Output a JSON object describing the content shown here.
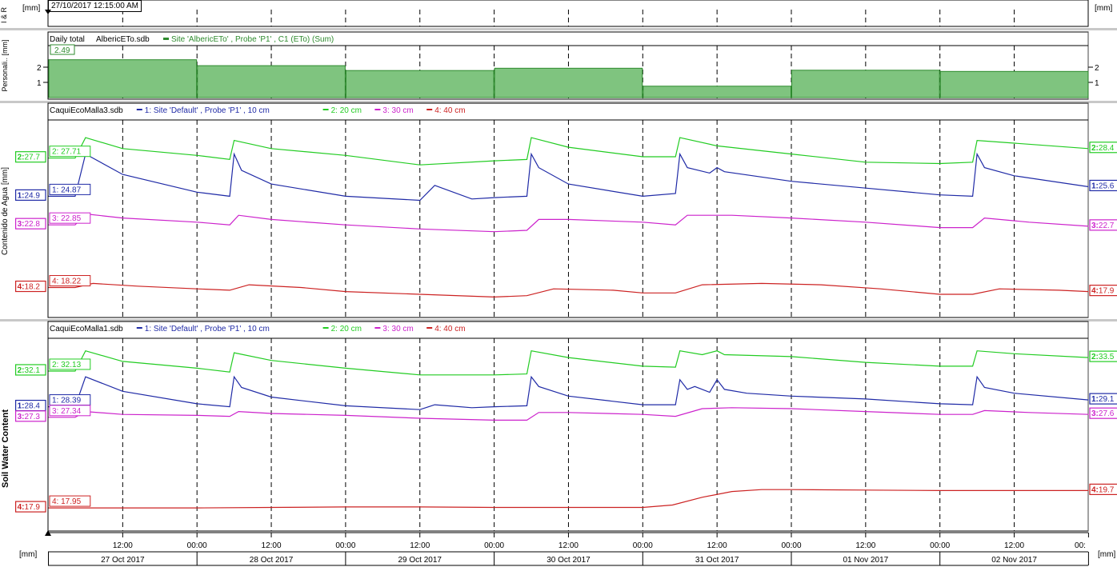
{
  "timestamp": "27/10/2017 12:15:00 AM",
  "top_panel": {
    "unit_left": "[mm]",
    "unit_right": "[mm]",
    "ylabel": "I & R"
  },
  "bottom_units": {
    "left": "[mm]",
    "right": "[mm]"
  },
  "colors": {
    "series_1": "#1f2aa6",
    "series_2": "#22cc22",
    "series_3": "#cc22cc",
    "series_4": "#cc2222",
    "bar_fill": "#7fc47f",
    "bar_edge": "#2e8b2e"
  },
  "x_axis": {
    "time_ticks": [
      "12:00",
      "00:00",
      "12:00",
      "00:00",
      "12:00",
      "00:00",
      "12:00",
      "00:00",
      "12:00",
      "00:00",
      "12:00",
      "00:00",
      "12:00",
      "00:"
    ],
    "days": [
      "27 Oct 2017",
      "28 Oct 2017",
      "29 Oct 2017",
      "30 Oct 2017",
      "31 Oct 2017",
      "01 Nov 2017",
      "02 Nov 2017"
    ]
  },
  "chart_data": [
    {
      "type": "bar",
      "panel": "Personalizado",
      "ylabel": "Personali.. [mm]",
      "legend": {
        "prefix": "Daily total",
        "file": "AlbericETo.sdb",
        "series": "Site 'AlbericETo' , Probe 'P1' , C1 (ETo) (Sum)"
      },
      "categories": [
        "27 Oct 2017",
        "28 Oct 2017",
        "29 Oct 2017",
        "30 Oct 2017",
        "31 Oct 2017",
        "01 Nov 2017",
        "02 Nov 2017"
      ],
      "values": [
        2.49,
        2.1,
        1.78,
        1.93,
        0.75,
        1.8,
        1.72
      ],
      "current_label": "2.49",
      "yticks": [
        "2",
        "1"
      ],
      "ylim": [
        0,
        3.2
      ]
    },
    {
      "type": "line",
      "panel": "CaquiEcoMalla3",
      "ylabel": "Contenido de Agua [mm]",
      "legend_file": "CaquiEcoMalla3.sdb",
      "series": [
        {
          "name": "1: Site 'Default' , Probe 'P1' , 10 cm",
          "cursor_label": "1: 24.87",
          "left_value": "1: 24.9",
          "right_value": "1: 25.6",
          "x": [
            0,
            0.18,
            0.25,
            0.5,
            1.0,
            1.22,
            1.25,
            1.3,
            1.5,
            2.0,
            2.5,
            2.6,
            2.85,
            3.0,
            3.22,
            3.25,
            3.3,
            3.5,
            4.0,
            4.22,
            4.25,
            4.3,
            4.45,
            4.5,
            4.55,
            5.0,
            5.5,
            6.0,
            6.22,
            6.25,
            6.3,
            6.5,
            7.0
          ],
          "y": [
            24.9,
            24.9,
            28.0,
            26.5,
            25.2,
            24.9,
            28.0,
            26.8,
            25.8,
            24.9,
            24.6,
            25.7,
            24.7,
            24.8,
            24.9,
            28.0,
            27.0,
            25.8,
            24.9,
            25.1,
            28.0,
            27.0,
            26.6,
            27.0,
            26.7,
            26.0,
            25.5,
            25.0,
            24.9,
            28.0,
            27.0,
            26.4,
            25.6
          ]
        },
        {
          "name": "2: 20 cm",
          "cursor_label": "2: 27.71",
          "left_value": "2: 27.7",
          "right_value": "2: 28.4",
          "x": [
            0,
            0.18,
            0.25,
            0.5,
            1.0,
            1.22,
            1.25,
            1.5,
            2.0,
            2.5,
            3.0,
            3.22,
            3.25,
            3.5,
            4.0,
            4.22,
            4.25,
            4.5,
            5.0,
            5.5,
            6.0,
            6.22,
            6.25,
            6.5,
            7.0
          ],
          "y": [
            27.7,
            27.7,
            29.2,
            28.4,
            27.9,
            27.6,
            29.0,
            28.4,
            27.9,
            27.2,
            27.5,
            27.6,
            29.2,
            28.5,
            27.8,
            27.8,
            29.2,
            28.6,
            28.0,
            27.4,
            27.3,
            27.4,
            29.0,
            28.8,
            28.4
          ]
        },
        {
          "name": "3: 30 cm",
          "cursor_label": "3: 22.85",
          "left_value": "3: 22.8",
          "right_value": "3: 22.7",
          "x": [
            0,
            0.18,
            0.25,
            0.5,
            1.0,
            1.22,
            1.28,
            1.5,
            2.0,
            2.5,
            3.0,
            3.22,
            3.3,
            3.5,
            4.0,
            4.22,
            4.3,
            4.6,
            5.0,
            5.5,
            6.0,
            6.22,
            6.3,
            6.6,
            7.0
          ],
          "y": [
            22.8,
            22.8,
            23.6,
            23.3,
            23.0,
            22.8,
            23.5,
            23.2,
            22.8,
            22.5,
            22.3,
            22.4,
            23.2,
            23.2,
            23.0,
            22.8,
            23.5,
            23.5,
            23.3,
            23.0,
            22.6,
            22.6,
            23.3,
            23.0,
            22.7
          ]
        },
        {
          "name": "4: 40 cm",
          "cursor_label": "4: 18.22",
          "left_value": "4: 18.2",
          "right_value": "4: 17.9",
          "x": [
            0,
            0.18,
            0.3,
            0.6,
            1.0,
            1.22,
            1.35,
            1.7,
            2.0,
            2.5,
            3.0,
            3.22,
            3.4,
            3.8,
            4.0,
            4.22,
            4.4,
            4.8,
            5.2,
            5.6,
            6.0,
            6.22,
            6.4,
            6.8,
            7.0
          ],
          "y": [
            18.2,
            18.2,
            18.5,
            18.3,
            18.1,
            18.0,
            18.4,
            18.2,
            17.9,
            17.7,
            17.5,
            17.6,
            18.1,
            18.0,
            17.8,
            17.8,
            18.4,
            18.5,
            18.4,
            18.1,
            17.7,
            17.7,
            18.1,
            18.0,
            17.9
          ]
        }
      ],
      "ylim": [
        16,
        30.5
      ]
    },
    {
      "type": "line",
      "panel": "CaquiEcoMalla1",
      "ylabel": "Soil Water Content",
      "legend_file": "CaquiEcoMalla1.sdb",
      "series": [
        {
          "name": "1: Site 'Default' , Probe 'P1' , 10 cm",
          "cursor_label": "1: 28.39",
          "left_value": "1: 28.4",
          "right_value": "1: 29.1",
          "x": [
            0,
            0.18,
            0.25,
            0.5,
            1.0,
            1.22,
            1.25,
            1.3,
            1.5,
            2.0,
            2.5,
            2.6,
            2.85,
            3.0,
            3.22,
            3.25,
            3.3,
            3.5,
            4.0,
            4.22,
            4.25,
            4.3,
            4.35,
            4.45,
            4.5,
            4.55,
            4.7,
            5.0,
            5.5,
            6.0,
            6.22,
            6.25,
            6.3,
            6.5,
            7.0
          ],
          "y": [
            28.4,
            28.4,
            31.5,
            30.0,
            28.7,
            28.4,
            31.5,
            30.4,
            29.4,
            28.5,
            28.1,
            28.6,
            28.3,
            28.4,
            28.5,
            31.5,
            30.5,
            29.5,
            28.6,
            28.6,
            31.2,
            30.2,
            30.5,
            29.9,
            31.2,
            30.2,
            29.8,
            29.5,
            29.2,
            28.7,
            28.6,
            31.5,
            30.4,
            29.8,
            29.1
          ]
        },
        {
          "name": "2: 20 cm",
          "cursor_label": "2: 32.13",
          "left_value": "2: 32.1",
          "right_value": "2: 33.5",
          "x": [
            0,
            0.18,
            0.25,
            0.5,
            1.0,
            1.22,
            1.25,
            1.5,
            2.0,
            2.5,
            3.0,
            3.22,
            3.25,
            3.5,
            4.0,
            4.22,
            4.25,
            4.4,
            4.5,
            4.55,
            5.0,
            5.5,
            6.0,
            6.22,
            6.25,
            6.5,
            7.0
          ],
          "y": [
            32.1,
            32.1,
            34.2,
            33.1,
            32.4,
            32.0,
            34.0,
            33.2,
            32.4,
            31.7,
            31.7,
            31.8,
            34.2,
            33.5,
            32.6,
            32.5,
            34.2,
            33.8,
            34.2,
            33.8,
            33.6,
            33.0,
            32.6,
            32.6,
            34.2,
            33.9,
            33.5
          ]
        },
        {
          "name": "3: 30 cm",
          "cursor_label": "3: 27.34",
          "left_value": "3: 27.3",
          "right_value": "3: 27.6",
          "x": [
            0,
            0.18,
            0.25,
            0.5,
            1.0,
            1.22,
            1.28,
            1.5,
            2.0,
            2.5,
            3.0,
            3.22,
            3.3,
            3.5,
            4.0,
            4.22,
            4.4,
            4.6,
            5.0,
            5.5,
            6.0,
            6.22,
            6.3,
            6.6,
            7.0
          ],
          "y": [
            27.3,
            27.3,
            27.9,
            27.6,
            27.5,
            27.4,
            27.9,
            27.7,
            27.5,
            27.2,
            27.0,
            27.0,
            27.8,
            27.8,
            27.6,
            27.4,
            28.2,
            28.3,
            28.2,
            27.9,
            27.6,
            27.6,
            28.0,
            27.8,
            27.6
          ]
        },
        {
          "name": "4: 40 cm",
          "cursor_label": "4: 17.95",
          "left_value": "4: 17.9",
          "right_value": "4: 19.7",
          "x": [
            0,
            0.5,
            1.0,
            1.5,
            2.0,
            2.5,
            3.0,
            3.5,
            4.0,
            4.2,
            4.4,
            4.6,
            4.8,
            5.0,
            5.5,
            6.0,
            6.5,
            7.0
          ],
          "y": [
            17.9,
            17.9,
            17.9,
            17.95,
            18.0,
            18.0,
            17.95,
            17.95,
            17.95,
            18.2,
            19.0,
            19.6,
            19.8,
            19.8,
            19.75,
            19.7,
            19.7,
            19.7
          ]
        }
      ],
      "ylim": [
        15.5,
        35.5
      ]
    }
  ]
}
